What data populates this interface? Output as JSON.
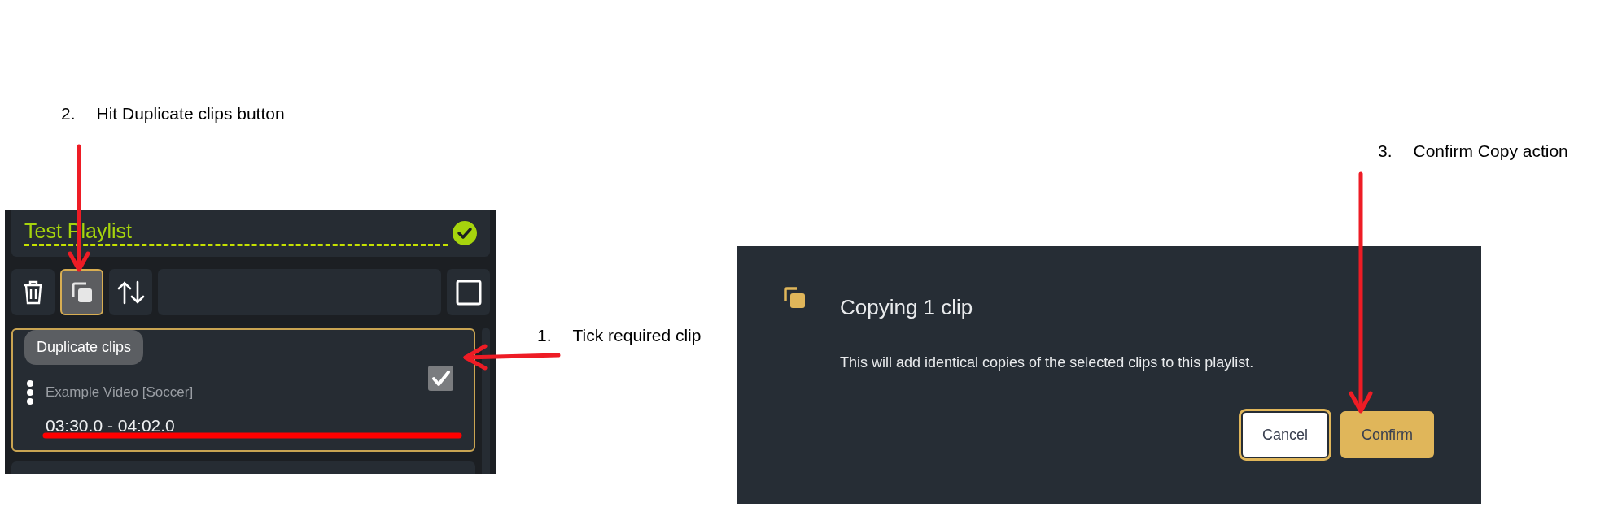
{
  "annotations": [
    {
      "number": "2.",
      "text": "Hit Duplicate clips button"
    },
    {
      "number": "1.",
      "text": "Tick required clip"
    },
    {
      "number": "3.",
      "text": "Confirm Copy action"
    }
  ],
  "playlist": {
    "title": "Test Playlist",
    "saved": true,
    "toolbar": [
      {
        "kind": "delete",
        "selected": false
      },
      {
        "kind": "duplicate",
        "selected": true
      },
      {
        "kind": "sort",
        "selected": false
      }
    ],
    "select_all": {
      "checked": false
    },
    "tooltip": "Duplicate clips",
    "clips": [
      {
        "source": "Example Video [Soccer]",
        "range": "03:30.0 - 04:02.0",
        "checked": true,
        "selected": true
      }
    ]
  },
  "dialog": {
    "title": "Copying 1 clip",
    "message": "This will add identical copies of the selected clips to this playlist.",
    "buttons": [
      {
        "label": "Cancel",
        "kind": "secondary",
        "focused": true
      },
      {
        "label": "Confirm",
        "kind": "primary",
        "focused": false
      }
    ]
  }
}
